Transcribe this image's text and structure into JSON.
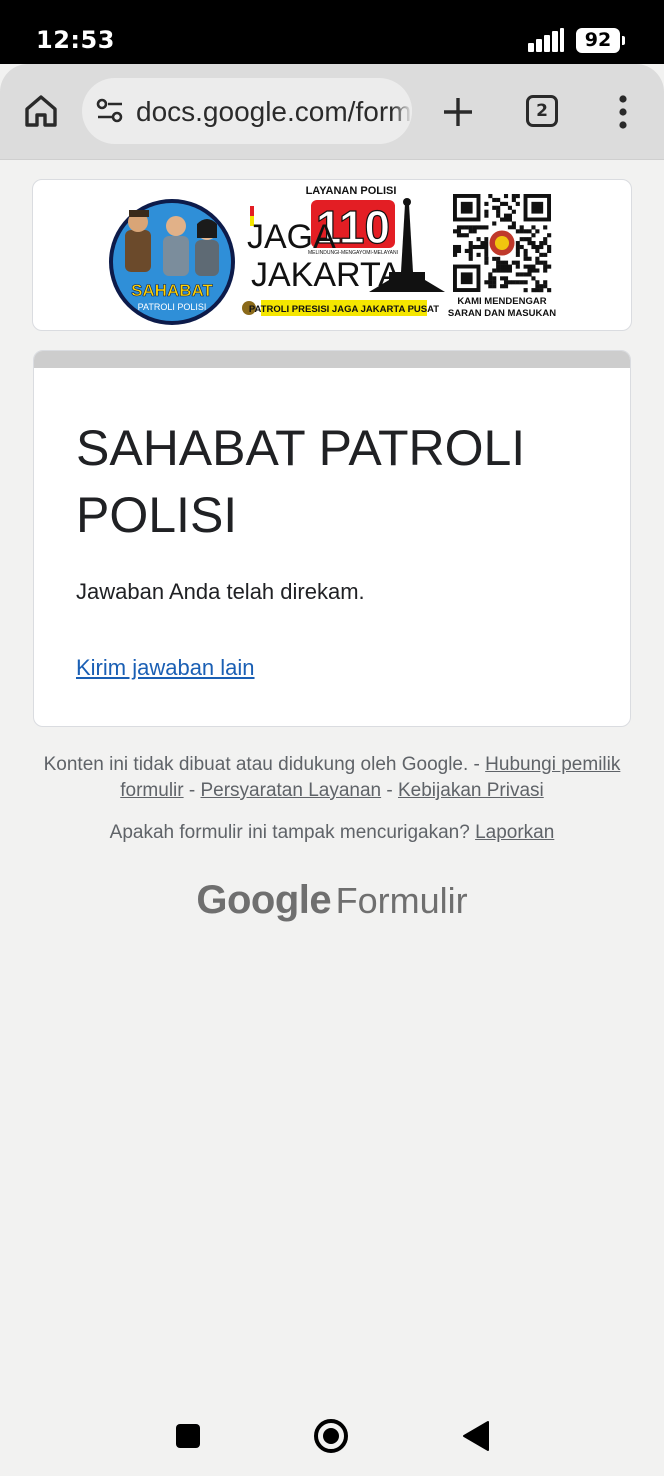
{
  "status": {
    "time": "12:53",
    "battery": "92"
  },
  "browser": {
    "url": "docs.google.com/forms",
    "tab_count": "2"
  },
  "banner": {
    "badge_top": "SAHABAT",
    "badge_bottom": "PATROLI POLISI",
    "layanan": "LAYANAN POLISI",
    "number": "110",
    "tagline_small": "MELINDUNGI-MENGAYOMI-MELAYANI",
    "jaga": "JAGA",
    "jakarta": "JAKARTA+",
    "strip": "PATROLI PRESISI JAGA JAKARTA PUSAT",
    "qr_caption_1": "KAMI MENDENGAR",
    "qr_caption_2": "SARAN DAN MASUKAN"
  },
  "form": {
    "title": "SAHABAT PATROLI POLISI",
    "confirmation": "Jawaban Anda telah direkam.",
    "another_link": "Kirim jawaban lain"
  },
  "footer": {
    "disclaimer_text": "Konten ini tidak dibuat atau didukung oleh Google. - ",
    "contact_link": "Hubungi pemilik formulir",
    "sep1": " - ",
    "terms_link": "Persyaratan Layanan",
    "sep2": " - ",
    "privacy_link": "Kebijakan Privasi",
    "report_text": "Apakah formulir ini tampak mencurigakan? ",
    "report_link": "Laporkan",
    "brand_google": "Google",
    "brand_forms": "Formulir"
  },
  "colors": {
    "link": "#1a5fb4",
    "banner_red": "#e31e24",
    "badge_blue": "#2f8fd8",
    "strip_yellow": "#f5e600"
  }
}
